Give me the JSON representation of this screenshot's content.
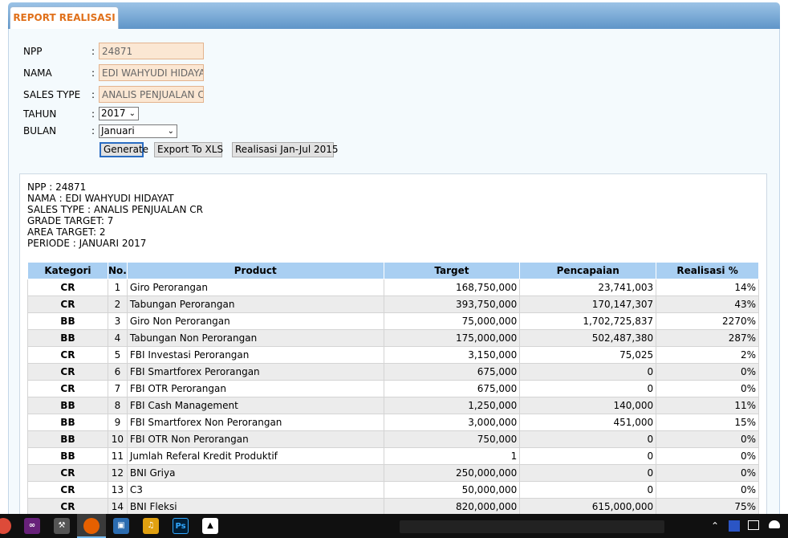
{
  "header": {
    "tab_title": "REPORT REALISASI"
  },
  "form": {
    "npp_label": "NPP",
    "npp_value": "24871",
    "nama_label": "NAMA",
    "nama_value": "EDI WAHYUDI HIDAYAT",
    "sales_type_label": "SALES TYPE",
    "sales_type_value": "ANALIS PENJUALAN CR",
    "tahun_label": "TAHUN",
    "tahun_value": "2017",
    "bulan_label": "BULAN",
    "bulan_value": "Januari",
    "colon": ":"
  },
  "buttons": {
    "generate": "Generate",
    "export": "Export To XLS",
    "realisasi": "Realisasi Jan-Jul 2015"
  },
  "info": {
    "npp": "NPP : 24871",
    "nama": "NAMA : EDI WAHYUDI HIDAYAT",
    "sales_type": "SALES TYPE : ANALIS PENJUALAN CR",
    "grade_target": "GRADE TARGET: 7",
    "area_target": "AREA TARGET: 2",
    "periode": "PERIODE : JANUARI 2017"
  },
  "table": {
    "headers": [
      "Kategori",
      "No.",
      "Product",
      "Target",
      "Pencapaian",
      "Realisasi %"
    ],
    "rows": [
      [
        "CR",
        "1",
        "Giro Perorangan",
        "168,750,000",
        "23,741,003",
        "14%"
      ],
      [
        "CR",
        "2",
        "Tabungan Perorangan",
        "393,750,000",
        "170,147,307",
        "43%"
      ],
      [
        "BB",
        "3",
        "Giro Non Perorangan",
        "75,000,000",
        "1,702,725,837",
        "2270%"
      ],
      [
        "BB",
        "4",
        "Tabungan Non Perorangan",
        "175,000,000",
        "502,487,380",
        "287%"
      ],
      [
        "CR",
        "5",
        "FBI Investasi Perorangan",
        "3,150,000",
        "75,025",
        "2%"
      ],
      [
        "CR",
        "6",
        "FBI Smartforex Perorangan",
        "675,000",
        "0",
        "0%"
      ],
      [
        "CR",
        "7",
        "FBI OTR Perorangan",
        "675,000",
        "0",
        "0%"
      ],
      [
        "BB",
        "8",
        "FBI Cash Management",
        "1,250,000",
        "140,000",
        "11%"
      ],
      [
        "BB",
        "9",
        "FBI Smartforex Non Perorangan",
        "3,000,000",
        "451,000",
        "15%"
      ],
      [
        "BB",
        "10",
        "FBI OTR Non Perorangan",
        "750,000",
        "0",
        "0%"
      ],
      [
        "BB",
        "11",
        "Jumlah Referal Kredit Produktif",
        "1",
        "0",
        "0%"
      ],
      [
        "CR",
        "12",
        "BNI Griya",
        "250,000,000",
        "0",
        "0%"
      ],
      [
        "CR",
        "13",
        "C3",
        "50,000,000",
        "0",
        "0%"
      ],
      [
        "CR",
        "14",
        "BNI Fleksi",
        "820,000,000",
        "615,000,000",
        "75%"
      ]
    ]
  },
  "taskbar": {
    "icons": [
      "chrome-icon",
      "visual-studio-icon",
      "tools-icon",
      "firefox-icon",
      "remote-desktop-icon",
      "media-icon",
      "photoshop-icon",
      "photos-icon"
    ],
    "ps_label": "Ps"
  }
}
